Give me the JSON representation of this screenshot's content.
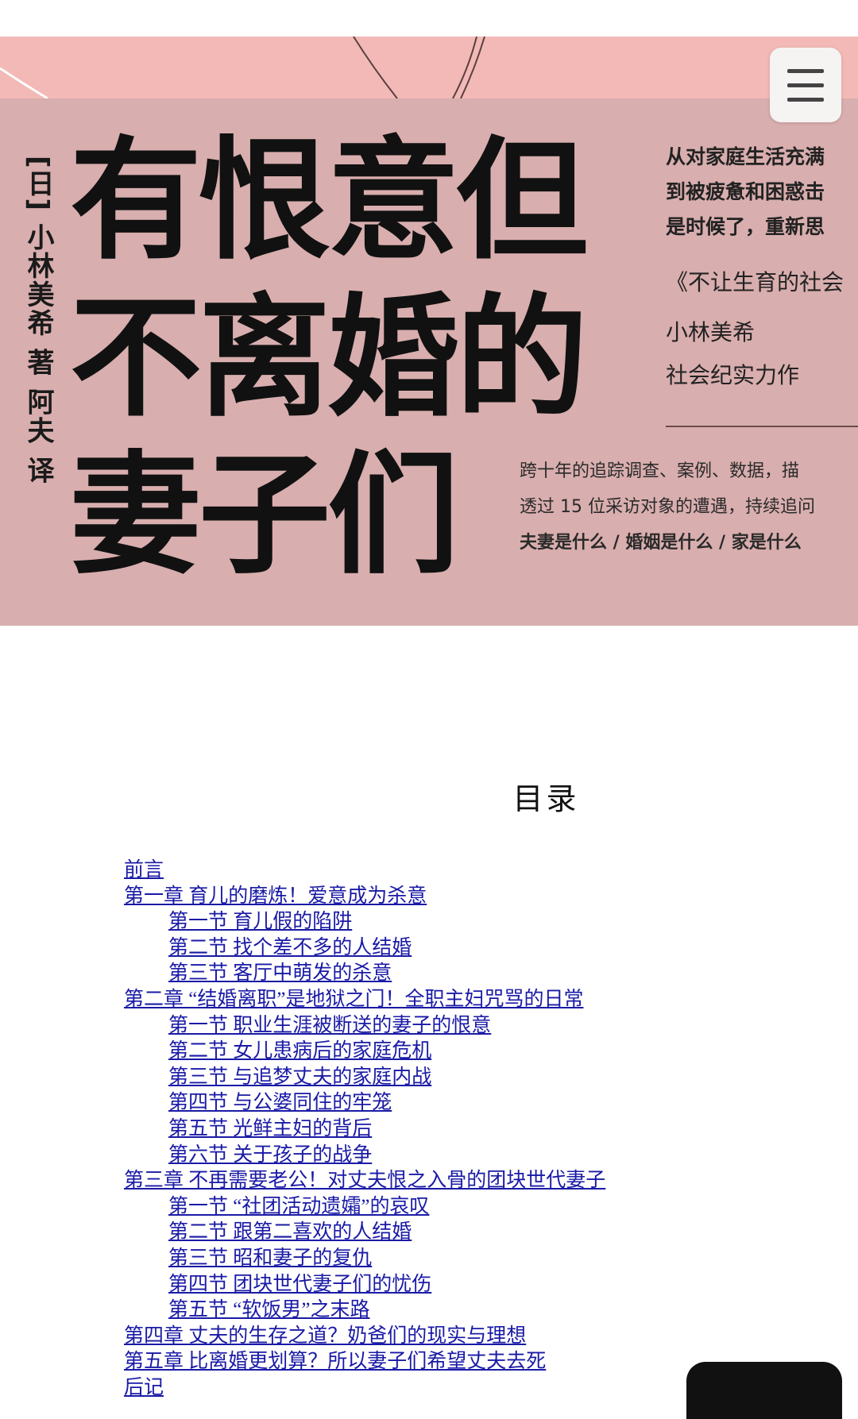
{
  "cover": {
    "author_vertical": "[日] 小林美希 著 阿夫 译",
    "title_lines": [
      "有恨意但",
      "不离婚的",
      "妻子们"
    ],
    "slogan_lines": [
      "从对家庭生活充满",
      "到被疲惫和困惑击",
      "是时候了，重新思"
    ],
    "series": "《不让生育的社会",
    "author_name": "小林美希",
    "subtitle": "社会纪实力作",
    "desc_lines": [
      "跨十年的追踪调查、案例、数据，描",
      "透过 15 位采访对象的遭遇，持续追问",
      "夫妻是什么 / 婚姻是什么 / 家是什么"
    ],
    "colors": {
      "background": "#d9aeae",
      "top_band": "#f2b9b6"
    }
  },
  "menu_button": {
    "icon": "hamburger-menu-icon"
  },
  "toc": {
    "title": "目录",
    "link_color": "#1a1aa6",
    "items": [
      {
        "label": "前言",
        "level": 1
      },
      {
        "label": "第一章 育儿的磨炼！爱意成为杀意",
        "level": 1
      },
      {
        "label": "第一节 育儿假的陷阱",
        "level": 2
      },
      {
        "label": "第二节 找个差不多的人结婚",
        "level": 2
      },
      {
        "label": "第三节 客厅中萌发的杀意",
        "level": 2
      },
      {
        "label": "第二章 “结婚离职”是地狱之门！全职主妇咒骂的日常",
        "level": 1
      },
      {
        "label": "第一节 职业生涯被断送的妻子的恨意",
        "level": 2
      },
      {
        "label": "第二节 女儿患病后的家庭危机",
        "level": 2
      },
      {
        "label": "第三节 与追梦丈夫的家庭内战",
        "level": 2
      },
      {
        "label": "第四节 与公婆同住的牢笼",
        "level": 2
      },
      {
        "label": "第五节 光鲜主妇的背后",
        "level": 2
      },
      {
        "label": "第六节 关于孩子的战争",
        "level": 2
      },
      {
        "label": "第三章 不再需要老公！对丈夫恨之入骨的团块世代妻子",
        "level": 1
      },
      {
        "label": "第一节 “社团活动遗孀”的哀叹",
        "level": 2
      },
      {
        "label": "第二节 跟第二喜欢的人结婚",
        "level": 2
      },
      {
        "label": "第三节 昭和妻子的复仇",
        "level": 2
      },
      {
        "label": "第四节 团块世代妻子们的忧伤",
        "level": 2
      },
      {
        "label": "第五节 “软饭男”之末路",
        "level": 2
      },
      {
        "label": "第四章 丈夫的生存之道？奶爸们的现实与理想",
        "level": 1
      },
      {
        "label": "第五章 比离婚更划算？所以妻子们希望丈夫去死",
        "level": 1
      },
      {
        "label": "后记",
        "level": 1
      }
    ]
  }
}
